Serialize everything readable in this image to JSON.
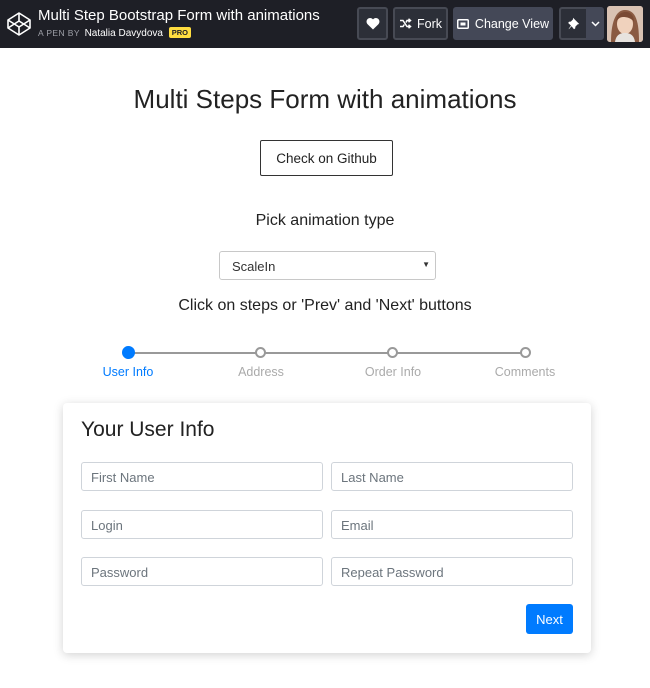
{
  "topbar": {
    "pen_title": "Multi Step Bootstrap Form with animations",
    "pen_by": "A PEN BY",
    "author": "Natalia Davydova",
    "pro_badge": "PRO",
    "buttons": {
      "heart_icon": "heart-icon",
      "fork_label": "Fork",
      "change_view_label": "Change View",
      "pin_icon": "pin-icon"
    }
  },
  "page": {
    "title": "Multi Steps Form with animations",
    "github_button": "Check on Github",
    "animation_label": "Pick animation type",
    "animation_select": {
      "selected": "ScaleIn"
    },
    "steps_hint": "Click on steps or 'Prev' and 'Next' buttons"
  },
  "steps": [
    {
      "label": "User Info",
      "active": true
    },
    {
      "label": "Address",
      "active": false
    },
    {
      "label": "Order Info",
      "active": false
    },
    {
      "label": "Comments",
      "active": false
    }
  ],
  "form": {
    "title": "Your User Info",
    "fields": {
      "first_name": "First Name",
      "last_name": "Last Name",
      "login": "Login",
      "email": "Email",
      "password": "Password",
      "repeat_password": "Repeat Password"
    },
    "next_button": "Next"
  },
  "colors": {
    "topbar_bg": "#1e1f26",
    "accent": "#007bff",
    "pro_badge": "#ffdd40"
  }
}
